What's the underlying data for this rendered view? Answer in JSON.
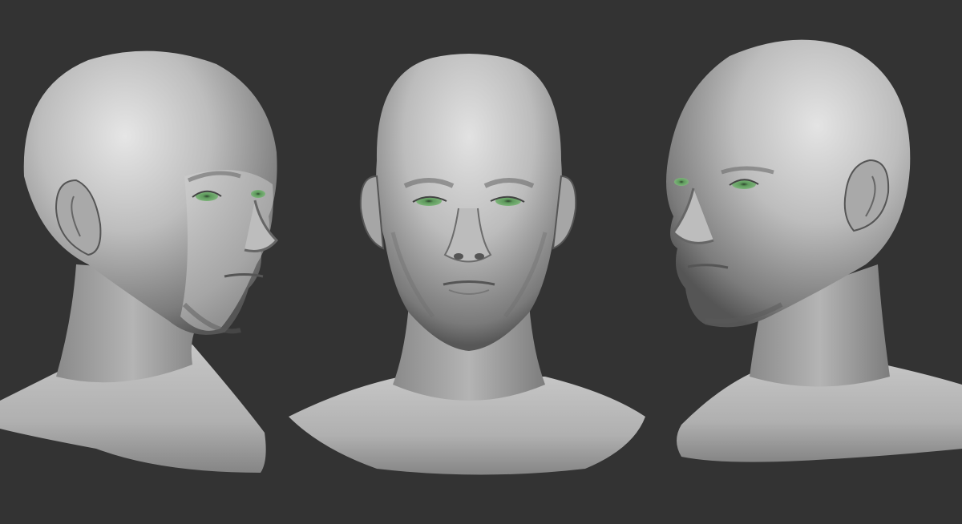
{
  "scene": {
    "background_color": "#333333",
    "material_color": "#c4c4c4",
    "material_shadow": "#4a4a4a",
    "eye_color": "#5e9a5c",
    "views": [
      {
        "id": "three-quarter-right",
        "icon": "head-sculpt-three-quarter"
      },
      {
        "id": "front",
        "icon": "head-sculpt-front"
      },
      {
        "id": "three-quarter-left",
        "icon": "head-sculpt-three-quarter-mirrored"
      }
    ]
  }
}
